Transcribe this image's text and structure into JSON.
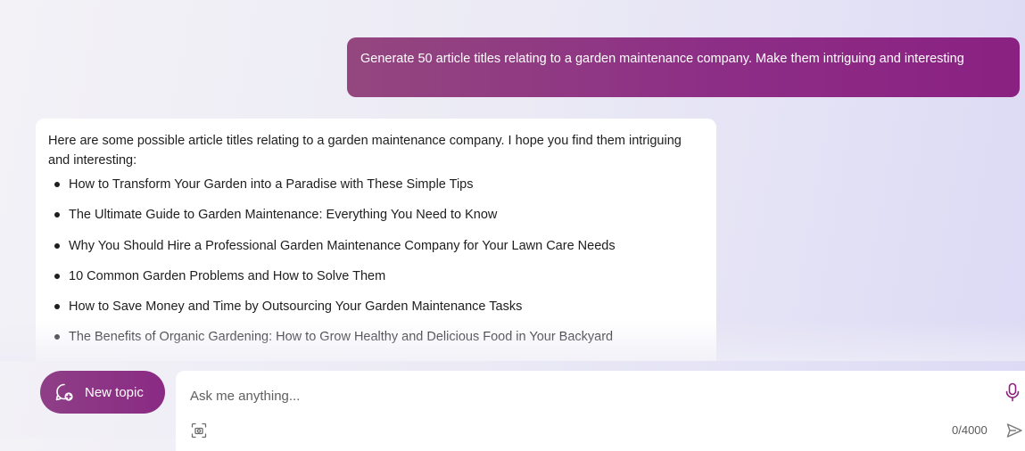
{
  "conversation": {
    "user_message": "Generate 50 article titles relating to a garden maintenance company. Make them intriguing and interesting",
    "bot_intro": "Here are some possible article titles relating to a garden maintenance company. I hope you find them intriguing and interesting:",
    "titles": [
      "How to Transform Your Garden into a Paradise with These Simple Tips",
      "The Ultimate Guide to Garden Maintenance: Everything You Need to Know",
      "Why You Should Hire a Professional Garden Maintenance Company for Your Lawn Care Needs",
      "10 Common Garden Problems and How to Solve Them",
      "How to Save Money and Time by Outsourcing Your Garden Maintenance Tasks",
      "The Benefits of Organic Gardening: How to Grow Healthy and Delicious Food in Your Backyard"
    ]
  },
  "composer": {
    "new_topic_label": "New topic",
    "placeholder": "Ask me anything...",
    "char_count": "0/4000"
  },
  "icons": {
    "new_topic": "chat-bubble-plus-icon",
    "microphone": "microphone-icon",
    "visual_search": "scan-camera-icon",
    "send": "send-icon"
  },
  "colors": {
    "accent_purple": "#8a2182",
    "user_bubble_start": "#94477f",
    "bot_bubble_bg": "#ffffff"
  }
}
